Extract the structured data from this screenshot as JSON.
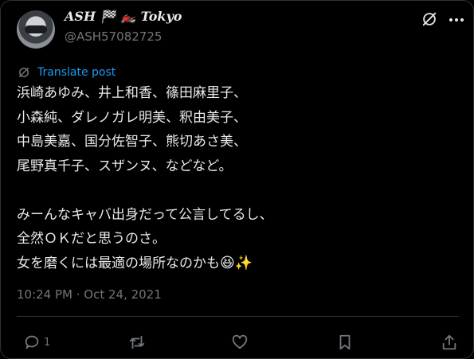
{
  "author": {
    "display_name": "ASH 🏁 🏍️ Tokyo",
    "handle": "@ASH57082725"
  },
  "translate_label": "Translate post",
  "post": {
    "lines": [
      "浜崎あゆみ、井上和香、篠田麻里子、",
      "小森純、ダレノガレ明美、釈由美子、",
      "中島美嘉、国分佐智子、熊切あさ美、",
      "尾野真千子、スザンヌ、などなど。",
      "",
      "みーんなキャバ出身だって公言してるし、",
      "全然ＯＫだと思うのさ。",
      "女を磨くには最適の場所なのかも"
    ],
    "emoji": "😆✨"
  },
  "timestamp": "10:24 PM · Oct 24, 2021",
  "actions": {
    "reply_count": "1"
  },
  "colors": {
    "background": "#000000",
    "text": "#e7e9ea",
    "muted": "#71767b",
    "link": "#1d9bf0",
    "border": "#2f3336"
  },
  "icons": [
    "grok-icon",
    "more-icon",
    "translate-icon",
    "reply-icon",
    "retweet-icon",
    "like-icon",
    "bookmark-icon",
    "share-icon"
  ]
}
